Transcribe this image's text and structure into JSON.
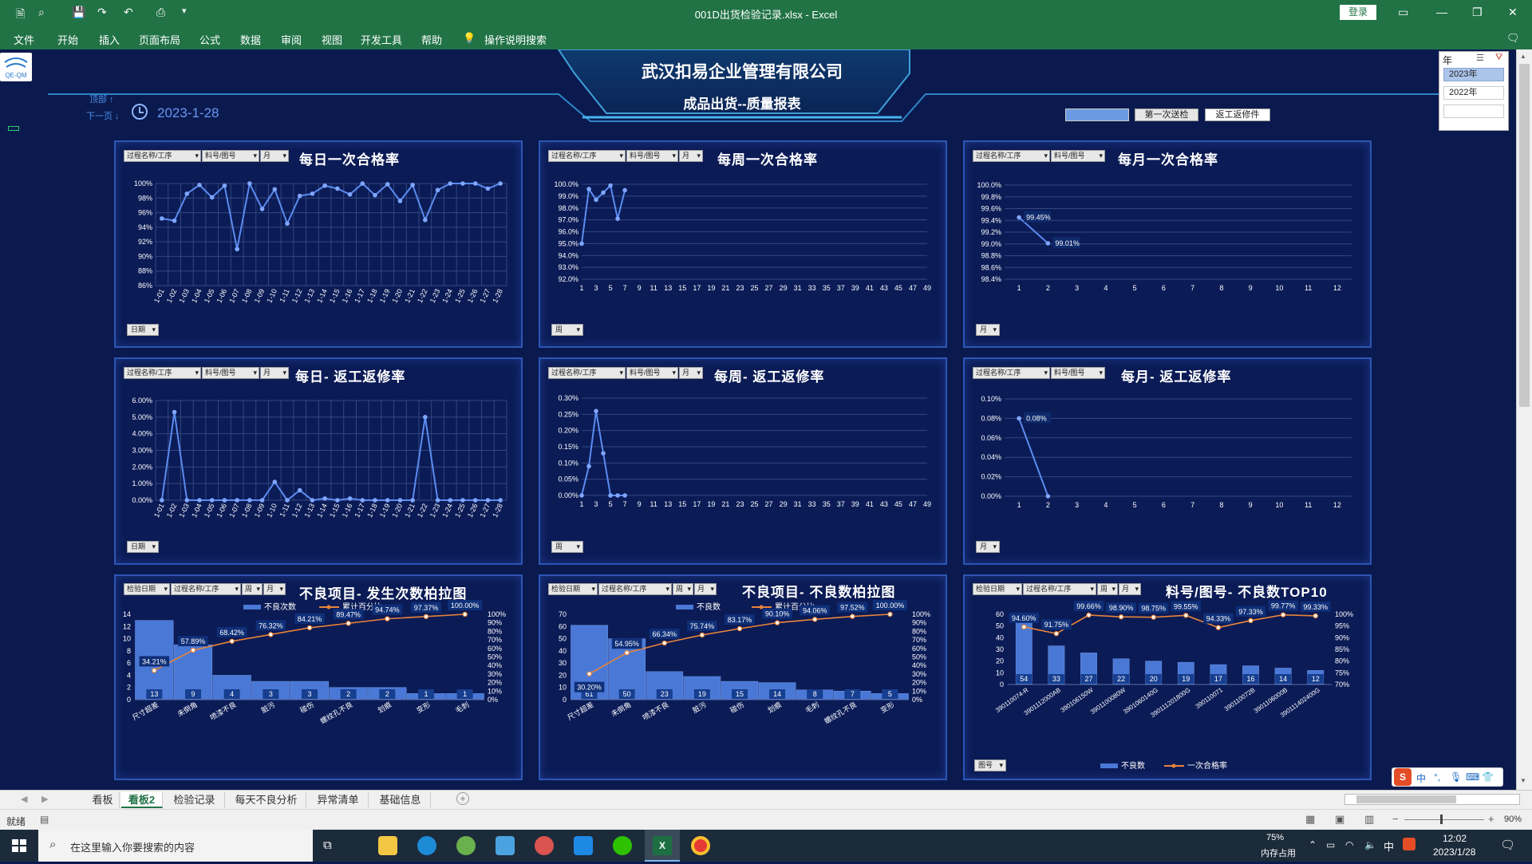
{
  "window": {
    "title": "001D出货检验记录.xlsx  -  Excel",
    "login": "登录"
  },
  "ribbon": {
    "menus": [
      "文件",
      "开始",
      "插入",
      "页面布局",
      "公式",
      "数据",
      "审阅",
      "视图",
      "开发工具",
      "帮助"
    ],
    "search": "操作说明搜索"
  },
  "header": {
    "company": "武汉扣易企业管理有限公司",
    "subtitle": "成品出货--质量报表",
    "nav_top": "顶部 ↑",
    "nav_next": "下一页 ↓",
    "date": "2023-1-28",
    "logo_text": "QE-QM",
    "slicer_buttons": [
      "",
      "第一次送检",
      "返工返修件"
    ],
    "year_slicer": {
      "title": "年",
      "items": [
        "2023年",
        "2022年",
        ""
      ]
    }
  },
  "colors": {
    "bg": "#0a1a4e",
    "panel_border": "#2d55b4",
    "line": "#5b8cf0",
    "bar": "#4a78d6",
    "cum_line": "#e8843a"
  },
  "panels": {
    "daily_pass": {
      "title": "每日一次合格率",
      "filters": [
        "过程名称/工序",
        "料号/图号",
        "月"
      ],
      "bottom_filter": "日期"
    },
    "weekly_pass": {
      "title": "每周一次合格率",
      "filters": [
        "过程名称/工序",
        "料号/图号",
        "月"
      ],
      "bottom_filter": "周"
    },
    "monthly_pass": {
      "title": "每月一次合格率",
      "filters": [
        "过程名称/工序",
        "料号/图号"
      ],
      "bottom_filter": "月"
    },
    "daily_rework": {
      "title": "每日- 返工返修率",
      "filters": [
        "过程名称/工序",
        "料号/图号",
        "月"
      ],
      "bottom_filter": "日期"
    },
    "weekly_rework": {
      "title": "每周- 返工返修率",
      "filters": [
        "过程名称/工序",
        "料号/图号",
        "月"
      ],
      "bottom_filter": "周"
    },
    "monthly_rework": {
      "title": "每月- 返工返修率",
      "filters": [
        "过程名称/工序",
        "料号/图号"
      ],
      "bottom_filter": "月"
    },
    "pareto_count": {
      "title": "不良项目- 发生次数柏拉图",
      "filters": [
        "检验日期",
        "过程名称/工序",
        "周",
        "月"
      ]
    },
    "pareto_qty": {
      "title": "不良项目- 不良数柏拉图",
      "filters": [
        "检验日期",
        "过程名称/工序",
        "周",
        "月"
      ]
    },
    "top10": {
      "title": "料号/图号- 不良数TOP10",
      "filters": [
        "检验日期",
        "过程名称/工序",
        "周",
        "月"
      ],
      "bottom_filter": "图号"
    }
  },
  "chart_data": [
    {
      "type": "line",
      "id": "daily_pass",
      "x": [
        "1-01",
        "1-02",
        "1-03",
        "1-04",
        "1-05",
        "1-06",
        "1-07",
        "1-08",
        "1-09",
        "1-10",
        "1-11",
        "1-12",
        "1-13",
        "1-14",
        "1-15",
        "1-16",
        "1-17",
        "1-18",
        "1-19",
        "1-20",
        "1-21",
        "1-22",
        "1-23",
        "1-24",
        "1-25",
        "1-26",
        "1-27",
        "1-28"
      ],
      "values": [
        95.2,
        94.9,
        98.6,
        99.8,
        98.1,
        99.7,
        91.0,
        100.0,
        96.5,
        99.2,
        94.5,
        98.3,
        98.6,
        99.7,
        99.3,
        98.5,
        100.0,
        98.4,
        99.9,
        97.6,
        99.8,
        95.0,
        99.1,
        100.0,
        100.0,
        100.0,
        99.3,
        100.0
      ],
      "yticks": [
        "100%",
        "98%",
        "96%",
        "94%",
        "92%",
        "90%",
        "88%",
        "86%"
      ],
      "ylim": [
        86,
        100
      ]
    },
    {
      "type": "line",
      "id": "weekly_pass",
      "x": [
        "1",
        "3",
        "5",
        "7",
        "9",
        "11",
        "13",
        "15",
        "17",
        "19",
        "21",
        "23",
        "25",
        "27",
        "29",
        "31",
        "33",
        "35",
        "37",
        "39",
        "41",
        "43",
        "45",
        "47",
        "49"
      ],
      "points": [
        [
          1,
          95.0
        ],
        [
          2,
          99.6
        ],
        [
          3,
          98.7
        ],
        [
          4,
          99.3
        ],
        [
          5,
          99.9
        ],
        [
          6,
          97.1
        ],
        [
          7,
          99.5
        ]
      ],
      "yticks": [
        "100.0%",
        "99.0%",
        "98.0%",
        "97.0%",
        "96.0%",
        "95.0%",
        "94.0%",
        "93.0%",
        "92.0%"
      ],
      "ylim": [
        92,
        100
      ],
      "xlim": [
        1,
        49
      ]
    },
    {
      "type": "line",
      "id": "monthly_pass",
      "x": [
        "1",
        "2",
        "3",
        "4",
        "5",
        "6",
        "7",
        "8",
        "9",
        "10",
        "11",
        "12"
      ],
      "points": [
        [
          1,
          99.45
        ],
        [
          2,
          99.01
        ]
      ],
      "labels": [
        "99.45%",
        "99.01%"
      ],
      "yticks": [
        "100.0%",
        "99.8%",
        "99.6%",
        "99.4%",
        "99.2%",
        "99.0%",
        "98.8%",
        "98.6%",
        "98.4%"
      ],
      "ylim": [
        98.4,
        100
      ]
    },
    {
      "type": "line",
      "id": "daily_rework",
      "x": [
        "1-01",
        "1-02",
        "1-03",
        "1-04",
        "1-05",
        "1-06",
        "1-07",
        "1-08",
        "1-09",
        "1-10",
        "1-11",
        "1-12",
        "1-13",
        "1-14",
        "1-15",
        "1-16",
        "1-17",
        "1-18",
        "1-19",
        "1-20",
        "1-21",
        "1-22",
        "1-23",
        "1-24",
        "1-25",
        "1-26",
        "1-27",
        "1-28"
      ],
      "values": [
        0,
        5.3,
        0,
        0,
        0,
        0,
        0,
        0,
        0,
        1.1,
        0,
        0.6,
        0,
        0.1,
        0,
        0.1,
        0,
        0,
        0,
        0,
        0,
        5.0,
        0,
        0,
        0,
        0,
        0,
        0
      ],
      "yticks": [
        "6.00%",
        "5.00%",
        "4.00%",
        "3.00%",
        "2.00%",
        "1.00%",
        "0.00%"
      ],
      "ylim": [
        0,
        6
      ]
    },
    {
      "type": "line",
      "id": "weekly_rework",
      "x": [
        "1",
        "3",
        "5",
        "7",
        "9",
        "11",
        "13",
        "15",
        "17",
        "19",
        "21",
        "23",
        "25",
        "27",
        "29",
        "31",
        "33",
        "35",
        "37",
        "39",
        "41",
        "43",
        "45",
        "47",
        "49"
      ],
      "points": [
        [
          1,
          0
        ],
        [
          2,
          0.09
        ],
        [
          3,
          0.26
        ],
        [
          4,
          0.13
        ],
        [
          5,
          0
        ],
        [
          6,
          0
        ],
        [
          7,
          0
        ]
      ],
      "yticks": [
        "0.30%",
        "0.25%",
        "0.20%",
        "0.15%",
        "0.10%",
        "0.05%",
        "0.00%"
      ],
      "ylim": [
        0,
        0.3
      ],
      "xlim": [
        1,
        49
      ]
    },
    {
      "type": "line",
      "id": "monthly_rework",
      "x": [
        "1",
        "2",
        "3",
        "4",
        "5",
        "6",
        "7",
        "8",
        "9",
        "10",
        "11",
        "12"
      ],
      "points": [
        [
          1,
          0.08
        ],
        [
          2,
          0
        ]
      ],
      "labels": [
        "0.08%",
        ""
      ],
      "yticks": [
        "0.10%",
        "0.08%",
        "0.06%",
        "0.04%",
        "0.02%",
        "0.00%"
      ],
      "ylim": [
        0,
        0.1
      ]
    },
    {
      "type": "bar",
      "id": "pareto_count",
      "categories": [
        "尺寸超差",
        "未倒角",
        "喷漆不良",
        "脏污",
        "碰伤",
        "螺纹孔不良",
        "划痕",
        "变形",
        "毛刺"
      ],
      "series": [
        {
          "name": "不良次数",
          "values": [
            13,
            9,
            4,
            3,
            3,
            2,
            2,
            1,
            1
          ]
        },
        {
          "name": "累计百分比",
          "values": [
            34.21,
            57.89,
            68.42,
            76.32,
            84.21,
            89.47,
            94.74,
            97.37,
            100.0
          ]
        }
      ],
      "labels": [
        "34.21%",
        "57.89%",
        "68.42%",
        "76.32%",
        "84.21%",
        "89.47%",
        "94.74%",
        "97.37%",
        "100.00%"
      ],
      "yticks": [
        "14",
        "12",
        "10",
        "8",
        "6",
        "4",
        "2",
        "0"
      ],
      "ylim": [
        0,
        14
      ],
      "y2ticks": [
        "100%",
        "90%",
        "80%",
        "70%",
        "60%",
        "50%",
        "40%",
        "30%",
        "20%",
        "10%",
        "0%"
      ]
    },
    {
      "type": "bar",
      "id": "pareto_qty",
      "categories": [
        "尺寸超差",
        "未倒角",
        "喷漆不良",
        "脏污",
        "碰伤",
        "划痕",
        "毛刺",
        "螺纹孔不良",
        "变形"
      ],
      "series": [
        {
          "name": "不良数",
          "values": [
            61,
            50,
            23,
            19,
            15,
            14,
            8,
            7,
            5
          ]
        },
        {
          "name": "累计百分比",
          "values": [
            30.2,
            54.95,
            66.34,
            75.74,
            83.17,
            90.1,
            94.06,
            97.52,
            100.0
          ]
        }
      ],
      "labels": [
        "30.20%",
        "54.95%",
        "66.34%",
        "75.74%",
        "83.17%",
        "90.10%",
        "94.06%",
        "97.52%",
        "100.00%"
      ],
      "yticks": [
        "70",
        "60",
        "50",
        "40",
        "30",
        "20",
        "10",
        "0"
      ],
      "ylim": [
        0,
        70
      ],
      "y2ticks": [
        "100%",
        "90%",
        "80%",
        "70%",
        "60%",
        "50%",
        "40%",
        "30%",
        "20%",
        "10%",
        "0%"
      ]
    },
    {
      "type": "bar",
      "id": "top10",
      "categories": [
        "390110074-R",
        "3901112000AB",
        "390106150W",
        "3901100080W",
        "3901060140G",
        "390111201800G",
        "390110071",
        "390110072B",
        "3901106000B",
        "390111402400G"
      ],
      "series": [
        {
          "name": "不良数",
          "values": [
            54,
            33,
            27,
            22,
            20,
            19,
            17,
            16,
            14,
            12
          ]
        },
        {
          "name": "一次合格率",
          "values": [
            94.6,
            91.75,
            99.66,
            98.9,
            98.75,
            99.55,
            94.33,
            97.33,
            99.77,
            99.33
          ]
        }
      ],
      "labels": [
        "94.60%",
        "91.75%",
        "99.66%",
        "98.90%",
        "98.75%",
        "99.55%",
        "94.33%",
        "97.33%",
        "99.77%",
        "99.33%"
      ],
      "yticks": [
        "60",
        "50",
        "40",
        "30",
        "20",
        "10",
        "0"
      ],
      "ylim": [
        0,
        60
      ],
      "y2ticks": [
        "100%",
        "95%",
        "90%",
        "85%",
        "80%",
        "75%",
        "70%"
      ],
      "y2lim": [
        70,
        100
      ]
    }
  ],
  "sheet_tabs": [
    "看板",
    "看板2",
    "检验记录",
    "每天不良分析",
    "异常清单",
    "基础信息"
  ],
  "status": {
    "ready": "就绪",
    "zoom": "90%"
  },
  "taskbar": {
    "search": "在这里输入你要搜索的内容",
    "mem_pct": "75%",
    "mem_label": "内存占用",
    "time": "12:02",
    "date": "2023/1/28",
    "ime": "中"
  }
}
